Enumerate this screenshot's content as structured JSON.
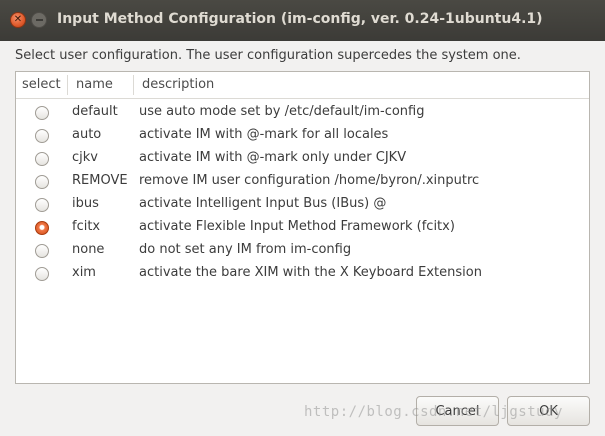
{
  "window": {
    "title": "Input Method Configuration (im-config, ver. 0.24-1ubuntu4.1)",
    "close_icon": "close-icon",
    "minimize_icon": "minimize-icon"
  },
  "prompt": "Select user configuration. The user configuration supercedes the system one.",
  "table": {
    "headers": {
      "select": "select",
      "name": "name",
      "description": "description"
    },
    "rows": [
      {
        "name": "default",
        "description": "use auto mode set by /etc/default/im-config",
        "selected": false
      },
      {
        "name": "auto",
        "description": "activate IM with @-mark for all locales",
        "selected": false
      },
      {
        "name": "cjkv",
        "description": "activate IM with @-mark only under CJKV",
        "selected": false
      },
      {
        "name": "REMOVE",
        "description": "remove IM user configuration /home/byron/.xinputrc",
        "selected": false
      },
      {
        "name": "ibus",
        "description": "activate Intelligent Input Bus (IBus) @",
        "selected": false
      },
      {
        "name": "fcitx",
        "description": "activate Flexible Input Method Framework (fcitx)",
        "selected": true
      },
      {
        "name": "none",
        "description": "do not set any IM from im-config",
        "selected": false
      },
      {
        "name": "xim",
        "description": "activate the bare XIM with the X Keyboard Extension",
        "selected": false
      }
    ]
  },
  "buttons": {
    "cancel": "Cancel",
    "ok": "OK"
  },
  "watermark": "http://blog.csdn.net/ljgstudy",
  "colors": {
    "titlebar": "#3c3b37",
    "accent": "#e05a2b",
    "dialog_bg": "#f2f1f0"
  }
}
